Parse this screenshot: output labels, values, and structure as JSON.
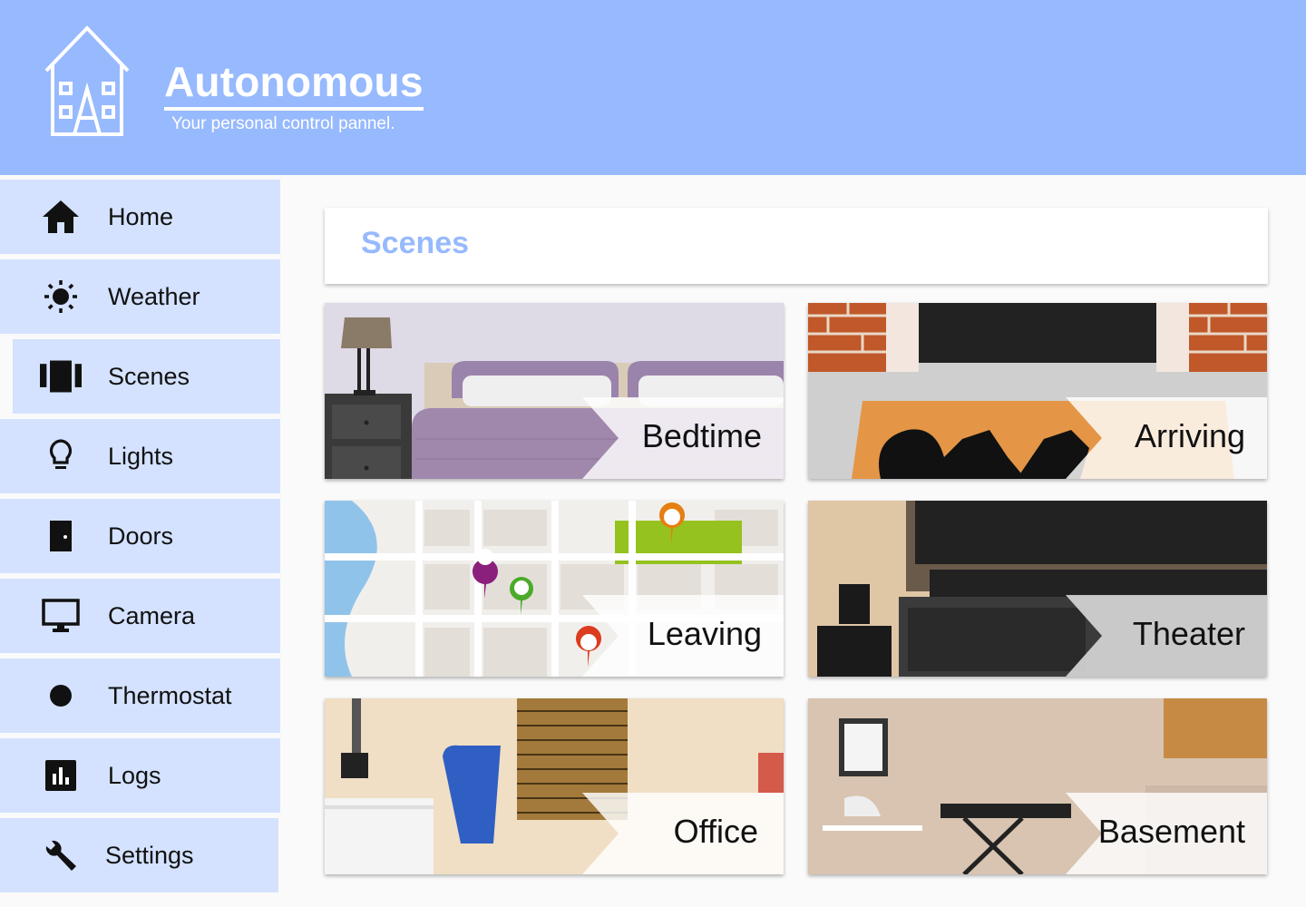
{
  "header": {
    "title": "Autonomous",
    "subtitle": "Your personal control pannel."
  },
  "sidebar": {
    "items": [
      {
        "label": "Home",
        "icon": "home-icon"
      },
      {
        "label": "Weather",
        "icon": "sun-icon"
      },
      {
        "label": "Scenes",
        "icon": "scenes-icon",
        "active": true
      },
      {
        "label": "Lights",
        "icon": "lightbulb-icon"
      },
      {
        "label": "Doors",
        "icon": "door-icon"
      },
      {
        "label": "Camera",
        "icon": "monitor-icon"
      },
      {
        "label": "Thermostat",
        "icon": "circle-icon"
      },
      {
        "label": "Logs",
        "icon": "bar-chart-icon"
      },
      {
        "label": "Settings",
        "icon": "wrench-icon"
      }
    ]
  },
  "main": {
    "title": "Scenes",
    "scenes": [
      {
        "label": "Bedtime"
      },
      {
        "label": "Arriving"
      },
      {
        "label": "Leaving"
      },
      {
        "label": "Theater"
      },
      {
        "label": "Office"
      },
      {
        "label": "Basement"
      }
    ]
  },
  "colors": {
    "accent": "#97b9fe",
    "nav_background": "#d4e2ff"
  }
}
